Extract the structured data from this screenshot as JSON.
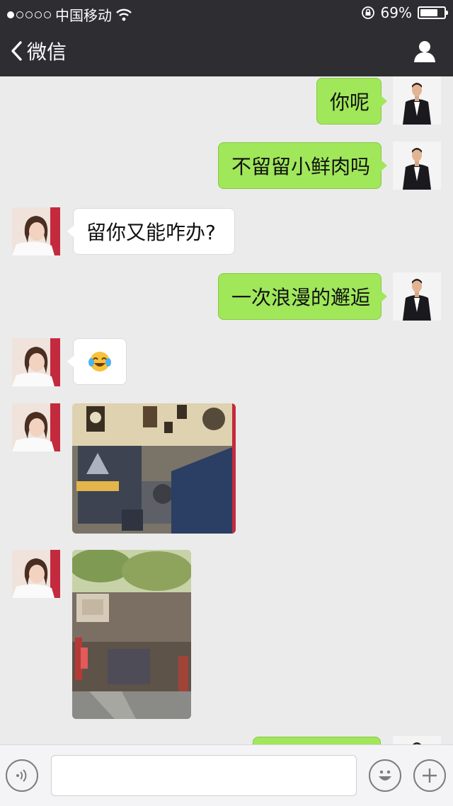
{
  "status": {
    "carrier": "中国移动",
    "battery": "69%",
    "battery_level": 0.69
  },
  "nav": {
    "back_label": "微信"
  },
  "messages": {
    "m1": "你呢",
    "m2": "不留留小鲜肉吗",
    "m3": "留你又能咋办?",
    "m4": "一次浪漫的邂逅",
    "m5_emoji": "😂"
  },
  "colors": {
    "my_bubble": "#a0e75a",
    "her_bubble": "#ffffff",
    "nav_bg": "#2e2d32"
  }
}
